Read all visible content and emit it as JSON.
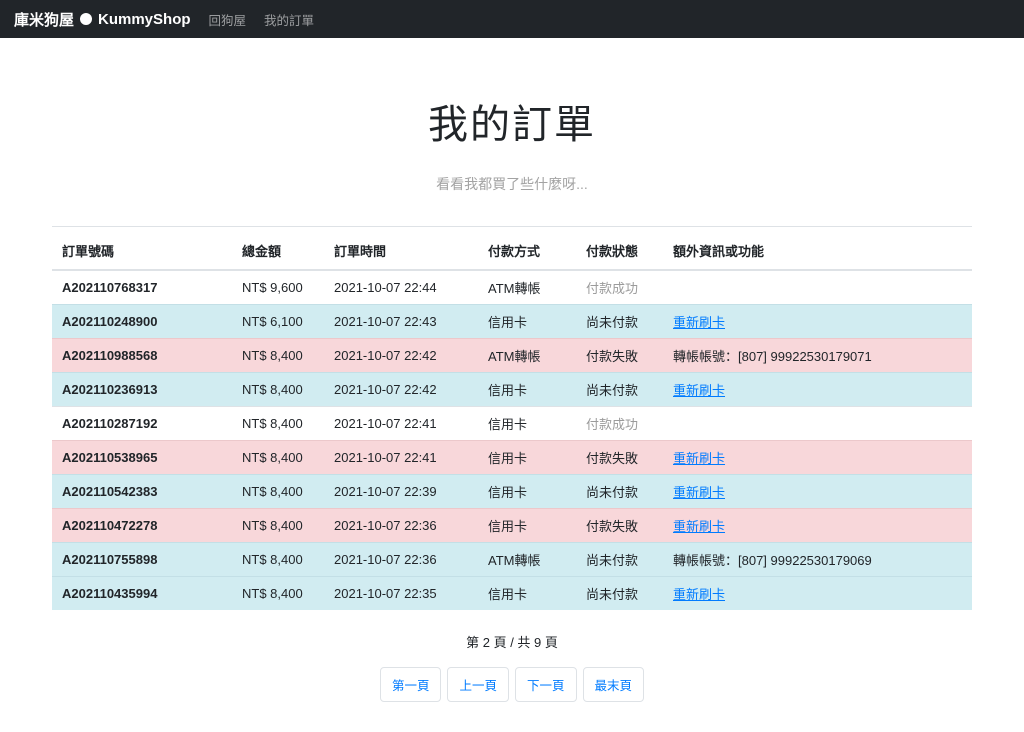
{
  "navbar": {
    "brand_left": "庫米狗屋",
    "brand_right": "KummyShop",
    "links": [
      {
        "label": "回狗屋"
      },
      {
        "label": "我的訂單"
      }
    ]
  },
  "page": {
    "title": "我的訂單",
    "subtitle": "看看我都買了些什麼呀..."
  },
  "table": {
    "headers": [
      "訂單號碼",
      "總金額",
      "訂單時間",
      "付款方式",
      "付款狀態",
      "額外資訊或功能"
    ],
    "rows": [
      {
        "order_id": "A202110768317",
        "amount": "NT$ 9,600",
        "time": "2021-10-07 22:44",
        "method": "ATM轉帳",
        "status": "付款成功",
        "status_muted": true,
        "extra": "",
        "extra_type": "none",
        "row_style": "plain"
      },
      {
        "order_id": "A202110248900",
        "amount": "NT$ 6,100",
        "time": "2021-10-07 22:43",
        "method": "信用卡",
        "status": "尚未付款",
        "status_muted": false,
        "extra": "重新刷卡",
        "extra_type": "link",
        "row_style": "info"
      },
      {
        "order_id": "A202110988568",
        "amount": "NT$ 8,400",
        "time": "2021-10-07 22:42",
        "method": "ATM轉帳",
        "status": "付款失敗",
        "status_muted": false,
        "extra": "轉帳帳號：[807] 99922530179071",
        "extra_type": "text",
        "row_style": "danger"
      },
      {
        "order_id": "A202110236913",
        "amount": "NT$ 8,400",
        "time": "2021-10-07 22:42",
        "method": "信用卡",
        "status": "尚未付款",
        "status_muted": false,
        "extra": "重新刷卡",
        "extra_type": "link",
        "row_style": "info"
      },
      {
        "order_id": "A202110287192",
        "amount": "NT$ 8,400",
        "time": "2021-10-07 22:41",
        "method": "信用卡",
        "status": "付款成功",
        "status_muted": true,
        "extra": "",
        "extra_type": "none",
        "row_style": "plain"
      },
      {
        "order_id": "A202110538965",
        "amount": "NT$ 8,400",
        "time": "2021-10-07 22:41",
        "method": "信用卡",
        "status": "付款失敗",
        "status_muted": false,
        "extra": "重新刷卡",
        "extra_type": "link",
        "row_style": "danger"
      },
      {
        "order_id": "A202110542383",
        "amount": "NT$ 8,400",
        "time": "2021-10-07 22:39",
        "method": "信用卡",
        "status": "尚未付款",
        "status_muted": false,
        "extra": "重新刷卡",
        "extra_type": "link",
        "row_style": "info"
      },
      {
        "order_id": "A202110472278",
        "amount": "NT$ 8,400",
        "time": "2021-10-07 22:36",
        "method": "信用卡",
        "status": "付款失敗",
        "status_muted": false,
        "extra": "重新刷卡",
        "extra_type": "link",
        "row_style": "danger"
      },
      {
        "order_id": "A202110755898",
        "amount": "NT$ 8,400",
        "time": "2021-10-07 22:36",
        "method": "ATM轉帳",
        "status": "尚未付款",
        "status_muted": false,
        "extra": "轉帳帳號：[807] 99922530179069",
        "extra_type": "text",
        "row_style": "info"
      },
      {
        "order_id": "A202110435994",
        "amount": "NT$ 8,400",
        "time": "2021-10-07 22:35",
        "method": "信用卡",
        "status": "尚未付款",
        "status_muted": false,
        "extra": "重新刷卡",
        "extra_type": "link",
        "row_style": "info"
      }
    ]
  },
  "pagination": {
    "summary": "第 2 頁 / 共 9 頁",
    "buttons": [
      "第一頁",
      "上一頁",
      "下一頁",
      "最末頁"
    ]
  },
  "colors": {
    "navbar_bg": "#212529",
    "accent_link": "#007bff",
    "info_row_bg": "#d1ecf1",
    "danger_row_bg": "#f8d7da",
    "muted_text": "#9b9b9b",
    "table_border": "#dee2e6"
  }
}
